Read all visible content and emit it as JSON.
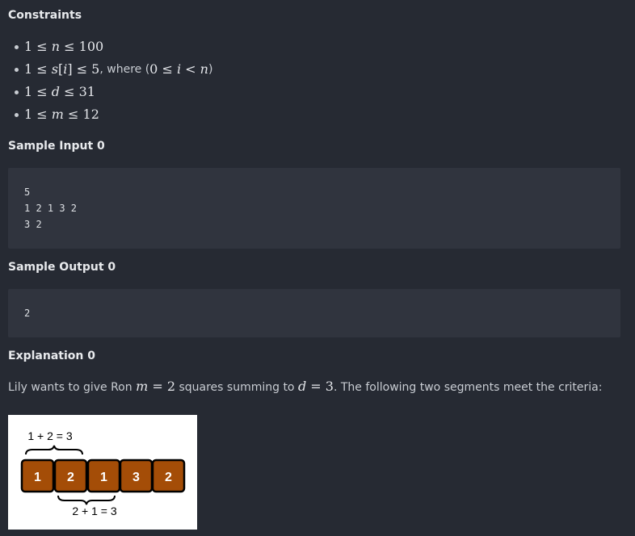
{
  "constraints": {
    "title": "Constraints",
    "items": [
      {
        "math": [
          "1 ≤ ",
          "n",
          " ≤ 100"
        ]
      },
      {
        "math": [
          "1 ≤ ",
          "s",
          "[",
          "i",
          "] ≤ 5"
        ],
        "suffix": ", where (",
        "math2": [
          "0 ≤ ",
          "i",
          " < ",
          "n"
        ],
        "close": ")"
      },
      {
        "math": [
          "1 ≤ ",
          "d",
          " ≤ 31"
        ]
      },
      {
        "math": [
          "1 ≤ ",
          "m",
          " ≤ 12"
        ]
      }
    ]
  },
  "sample_input": {
    "title": "Sample Input 0",
    "lines": [
      "5",
      "1 2 1 3 2",
      "3 2"
    ]
  },
  "sample_output": {
    "title": "Sample Output 0",
    "lines": [
      "2"
    ]
  },
  "explanation": {
    "title": "Explanation 0",
    "text_1": "Lily wants to give Ron ",
    "m_var": "m",
    "m_eq": " = 2",
    "text_2": " squares summing to ",
    "d_var": "d",
    "d_eq": " = 3",
    "text_3": ". The following two segments meet the criteria:"
  },
  "figure": {
    "squares": [
      "1",
      "2",
      "1",
      "3",
      "2"
    ],
    "top_label": "1 + 2 = 3",
    "bottom_label": "2 + 1 = 3",
    "square_fill": "#a44d07",
    "square_border": "#000000"
  }
}
